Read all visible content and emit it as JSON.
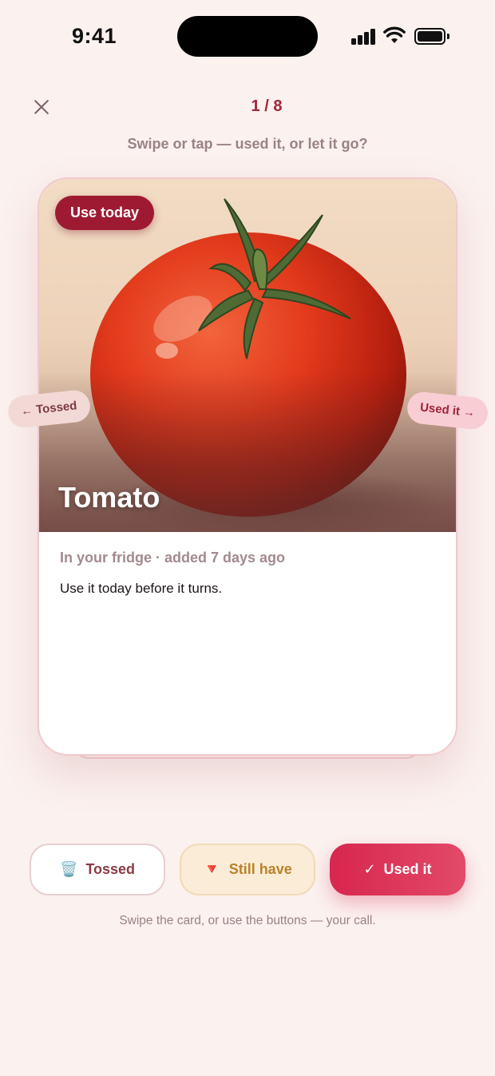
{
  "status_bar": {
    "time": "9:41"
  },
  "header": {
    "counter": "1 / 8",
    "subtitle": "Swipe or tap — used it, or let it go?"
  },
  "card": {
    "badge": "Use today",
    "item_name": "Tomato",
    "meta": "In your fridge · added 7 days ago",
    "description": "Use it today before it turns."
  },
  "swipe_hints": {
    "left": "← Tossed",
    "right": "Used it →"
  },
  "actions": {
    "tossed": {
      "icon": "🗑️",
      "label": "Tossed"
    },
    "still_have": {
      "icon": "🔻",
      "label": "Still have"
    },
    "used_it": {
      "icon": "✓",
      "label": "Used it"
    }
  },
  "footer_note": "Swipe the card, or use the buttons — your call.",
  "colors": {
    "accent": "#a0243a",
    "primary_button": "#d8264f",
    "background": "#fbf1ef"
  }
}
